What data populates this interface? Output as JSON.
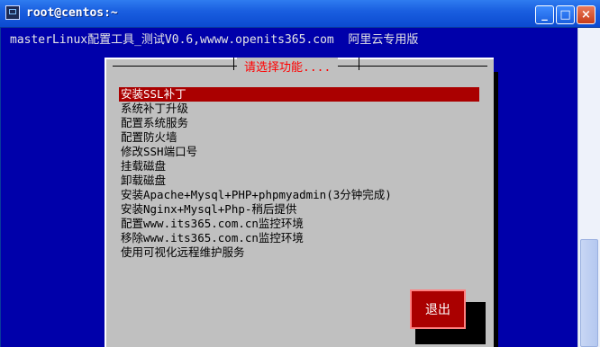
{
  "window": {
    "title": "root@centos:~",
    "controls": {
      "minimize": "_",
      "maximize": "□",
      "close": "×"
    }
  },
  "terminal": {
    "header": "masterLinux配置工具_测试V0.6,wwww.openits365.com  阿里云专用版"
  },
  "dialog": {
    "title": "请选择功能....",
    "items": [
      {
        "label": "安装SSL补丁",
        "selected": true
      },
      {
        "label": "系统补丁升级",
        "selected": false
      },
      {
        "label": "配置系统服务",
        "selected": false
      },
      {
        "label": "配置防火墙",
        "selected": false
      },
      {
        "label": "修改SSH端口号",
        "selected": false
      },
      {
        "label": "挂载磁盘",
        "selected": false
      },
      {
        "label": "卸载磁盘",
        "selected": false
      },
      {
        "label": "安装Apache+Mysql+PHP+phpmyadmin(3分钟完成)",
        "selected": false
      },
      {
        "label": "安装Nginx+Mysql+Php-稍后提供",
        "selected": false
      },
      {
        "label": "配置www.its365.com.cn监控环境",
        "selected": false
      },
      {
        "label": "移除www.its365.com.cn监控环境",
        "selected": false
      },
      {
        "label": "使用可视化远程维护服务",
        "selected": false
      }
    ],
    "exit_label": "退出"
  },
  "colors": {
    "terminal_bg": "#0000aa",
    "dialog_bg": "#c0c0c0",
    "selection": "#aa0000",
    "title_fg": "#ff0000"
  }
}
